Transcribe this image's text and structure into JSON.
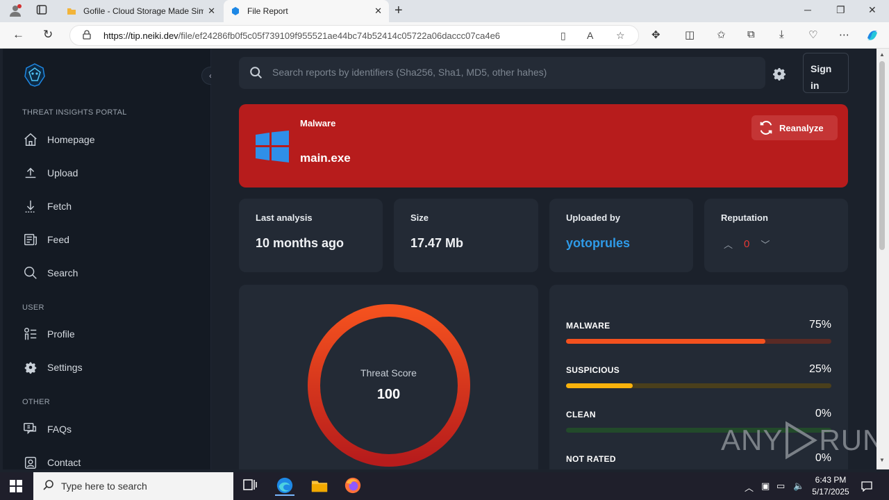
{
  "browser": {
    "tabs": [
      {
        "title": "Gofile - Cloud Storage Made Sim",
        "active": false
      },
      {
        "title": "File Report",
        "active": true
      }
    ],
    "url_host": "https://tip.neiki.dev",
    "url_path": "/file/ef24286fb0f5c05f739109f955521ae44bc74b52414c05722a06daccc07ca4e6"
  },
  "sidebar": {
    "section_portal": "THREAT INSIGHTS PORTAL",
    "section_user": "USER",
    "section_other": "OTHER",
    "items": {
      "homepage": "Homepage",
      "upload": "Upload",
      "fetch": "Fetch",
      "feed": "Feed",
      "search": "Search",
      "profile": "Profile",
      "settings": "Settings",
      "faqs": "FAQs",
      "contact": "Contact"
    }
  },
  "header": {
    "search_placeholder": "Search reports by identifiers (Sha256, Sha1, MD5, other hahes)",
    "signin_line1": "Sign",
    "signin_line2": "in"
  },
  "banner": {
    "verdict": "Malware",
    "filename": "main.exe",
    "reanalyze_label": "Reanalyze",
    "color": "#b71c1c"
  },
  "cards": {
    "last_analysis_label": "Last analysis",
    "last_analysis_value": "10 months ago",
    "size_label": "Size",
    "size_value": "17.47 Mb",
    "uploaded_by_label": "Uploaded by",
    "uploaded_by_value": "yotoprules",
    "reputation_label": "Reputation",
    "reputation_value": "0"
  },
  "threat": {
    "label": "Threat Score",
    "value": "100"
  },
  "stats": [
    {
      "name": "MALWARE",
      "pct_label": "75%",
      "fraction": 0.75,
      "color": "#f4511e",
      "track": "#5a2a25"
    },
    {
      "name": "SUSPICIOUS",
      "pct_label": "25%",
      "fraction": 0.25,
      "color": "#f9b20c",
      "track": "#4a3f1c"
    },
    {
      "name": "CLEAN",
      "pct_label": "0%",
      "fraction": 0.0,
      "color": "#2e7d32",
      "track": "#224a2a"
    },
    {
      "name": "NOT RATED",
      "pct_label": "0%",
      "fraction": 0.0,
      "color": "#9aa3ad",
      "track": "#3a4150"
    }
  ],
  "watermark": {
    "left": "ANY",
    "right": "RUN"
  },
  "taskbar": {
    "search_placeholder": "Type here to search",
    "time": "6:43 PM",
    "date": "5/17/2025"
  }
}
